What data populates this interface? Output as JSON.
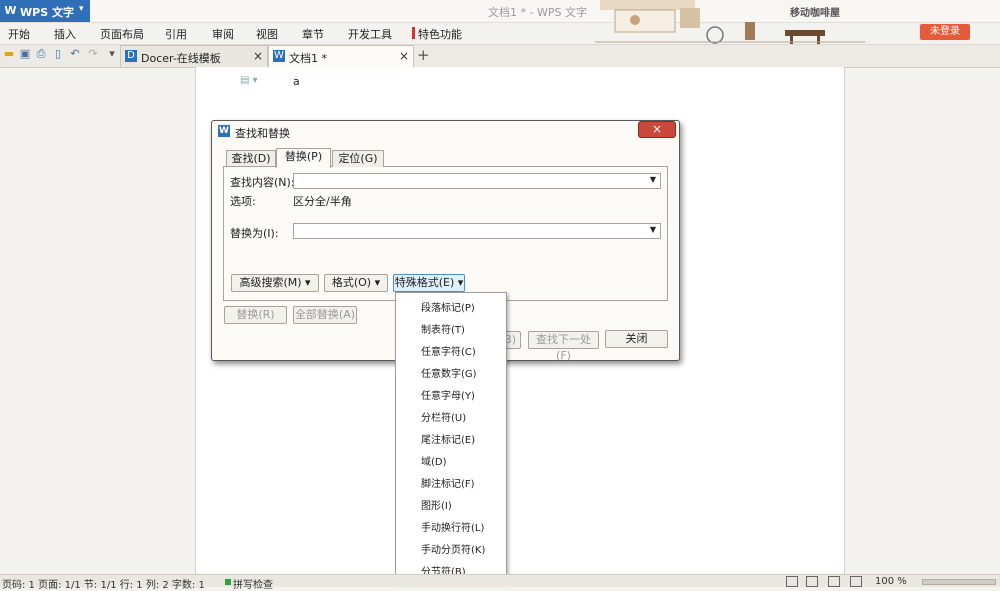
{
  "app": {
    "name": "WPS 文字",
    "doc_title": "文档1 * - WPS 文字",
    "login_label": "未登录",
    "coffee_label": "移动咖啡屋"
  },
  "menu": [
    "开始",
    "插入",
    "页面布局",
    "引用",
    "审阅",
    "视图",
    "章节",
    "开发工具",
    "特色功能"
  ],
  "tabs": [
    {
      "label": "Docer-在线模板",
      "close": "×"
    },
    {
      "label": "文档1 *",
      "close": "×"
    }
  ],
  "add_tab": "+",
  "document": {
    "text": "a"
  },
  "dialog": {
    "title": "查找和替换",
    "close": "×",
    "tabs": [
      "查找(D)",
      "替换(P)",
      "定位(G)"
    ],
    "find_label": "查找内容(N):",
    "find_value": "",
    "options_label": "选项:",
    "options_value": "区分全/半角",
    "replace_label": "替换为(I):",
    "replace_value": "",
    "advanced_button": "高级搜索(M) ▾",
    "format_button": "格式(O) ▾",
    "special_button": "特殊格式(E) ▾",
    "replace_button": "替换(R)",
    "replace_all_button": "全部替换(A)",
    "find_prev_button": "(B)",
    "find_next_button": "查找下一处(F)",
    "close_button": "关闭"
  },
  "special_menu": [
    "段落标记(P)",
    "制表符(T)",
    "任意字符(C)",
    "任意数字(G)",
    "任意字母(Y)",
    "分栏符(U)",
    "尾注标记(E)",
    "域(D)",
    "脚注标记(F)",
    "图形(I)",
    "手动换行符(L)",
    "手动分页符(K)",
    "分节符(B)"
  ],
  "status": {
    "text": "页码: 1  页面: 1/1  节: 1/1  行: 1  列: 2  字数: 1",
    "spell": "拼写检查",
    "zoom": "100 %"
  },
  "colors": {
    "accent": "#2f6fb8",
    "login": "#e65a3c",
    "dialog_close": "#c9483a"
  }
}
